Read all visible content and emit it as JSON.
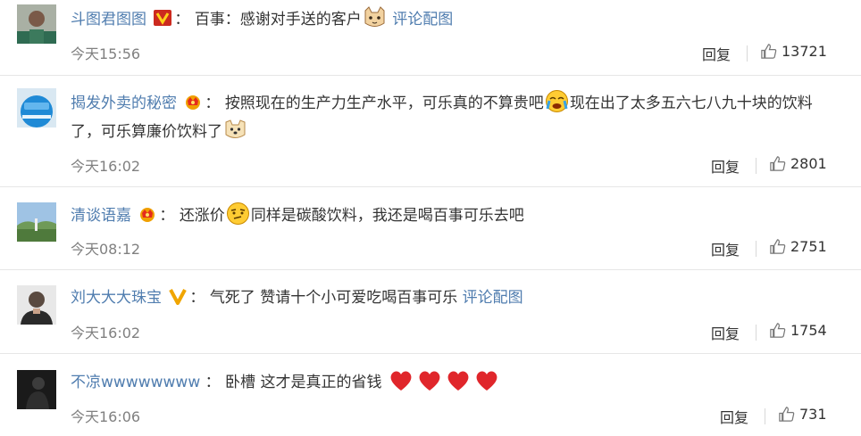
{
  "comments": [
    {
      "name": "斗图君图图",
      "text_parts": [
        "百事：感谢对手送的客户"
      ],
      "link": "评论配图",
      "time": "今天15:56",
      "reply": "回复",
      "likes": "13721"
    },
    {
      "name": "揭发外卖的秘密",
      "text_parts": [
        "按照现在的生产力生产水平，可乐真的不算贵吧",
        "现在出了太多五六七八九十块的饮料了，可乐算廉价饮料了"
      ],
      "time": "今天16:02",
      "reply": "回复",
      "likes": "2801"
    },
    {
      "name": "清谈语嘉",
      "text_parts": [
        "还涨价",
        "同样是碳酸饮料，我还是喝百事可乐去吧"
      ],
      "time": "今天08:12",
      "reply": "回复",
      "likes": "2751"
    },
    {
      "name": "刘大大大珠宝",
      "text_parts": [
        "气死了 赞请十个小可爱吃喝百事可乐"
      ],
      "link": "评论配图",
      "time": "今天16:02",
      "reply": "回复",
      "likes": "1754"
    },
    {
      "name": "不凉wwwwwwww",
      "text_parts": [
        "卧槽 这才是真正的省钱"
      ],
      "time": "今天16:06",
      "reply": "回复",
      "likes": "731"
    }
  ],
  "colon": "：",
  "icons": {
    "badge_v": "vip-v-badge-icon",
    "badge_crown": "crown-badge-icon",
    "like": "thumbs-up-icon",
    "emoji_cat": "cat-face-icon",
    "emoji_cry": "crying-face-icon",
    "emoji_dog": "dog-face-icon",
    "emoji_think": "thinking-face-icon",
    "heart": "heart-icon"
  },
  "colors": {
    "name": "#507daf",
    "time": "#808080",
    "text": "#333333",
    "heart": "#e0262b",
    "badge_v": "#e8a000"
  }
}
